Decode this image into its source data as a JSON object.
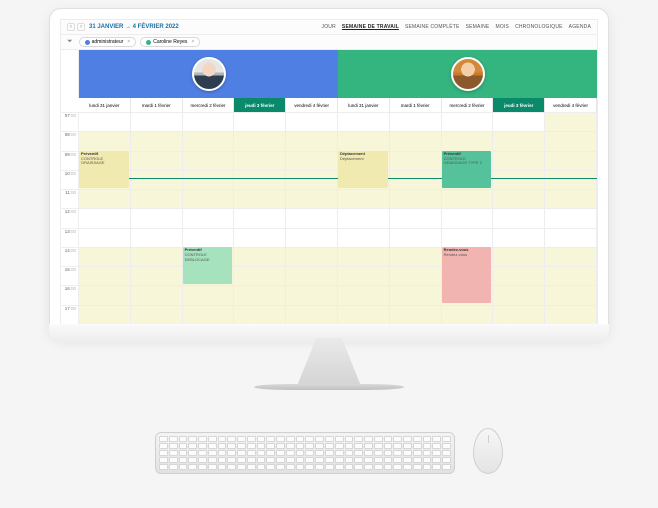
{
  "header": {
    "date_range": "31 JANVIER → 4 FÉVRIER 2022",
    "views": [
      {
        "label": "JOUR",
        "active": false
      },
      {
        "label": "SEMAINE DE TRAVAIL",
        "active": true
      },
      {
        "label": "SEMAINE COMPLÈTE",
        "active": false
      },
      {
        "label": "SEMAINE",
        "active": false
      },
      {
        "label": "MOIS",
        "active": false
      },
      {
        "label": "CHRONOLOGIQUE",
        "active": false
      },
      {
        "label": "AGENDA",
        "active": false
      }
    ]
  },
  "filters": [
    {
      "label": "administrateur",
      "color": "blue"
    },
    {
      "label": "Caroline Reyes",
      "color": "green"
    }
  ],
  "people": [
    {
      "name": "administrateur",
      "color": "blue"
    },
    {
      "name": "Caroline Reyes",
      "color": "green"
    }
  ],
  "days": [
    {
      "label": "lundi 31 janvier",
      "active": false
    },
    {
      "label": "mardi 1 février",
      "active": false
    },
    {
      "label": "mercredi 2 février",
      "active": false
    },
    {
      "label": "jeudi 3 février",
      "active": true
    },
    {
      "label": "vendredi 4 février",
      "active": false
    },
    {
      "label": "lundi 31 janvier",
      "active": false
    },
    {
      "label": "mardi 1 février",
      "active": false
    },
    {
      "label": "mercredi 2 février",
      "active": false
    },
    {
      "label": "jeudi 3 février",
      "active": true
    },
    {
      "label": "vendredi 4 février",
      "active": false
    }
  ],
  "hours": [
    "07",
    "08",
    "09",
    "10",
    "11",
    "12",
    "13",
    "14",
    "15",
    "16",
    "17"
  ],
  "events": [
    {
      "col": 0,
      "row": 2,
      "h": 2,
      "cls": "ev-yellow",
      "title": "Préventif",
      "sub": "CONTROLE GRAISSAGE"
    },
    {
      "col": 2,
      "row": 7,
      "h": 2,
      "cls": "ev-green",
      "title": "Préventif",
      "sub": "CONTROLE DEBLOCAGE"
    },
    {
      "col": 5,
      "row": 2,
      "h": 2,
      "cls": "ev-yellow",
      "title": "Déplacement",
      "sub": "Déplacement"
    },
    {
      "col": 7,
      "row": 2,
      "h": 2,
      "cls": "ev-teal",
      "title": "Préventif",
      "sub": "CONTROLE GRAISSAGE TYPE 2"
    },
    {
      "col": 7,
      "row": 7,
      "h": 3,
      "cls": "ev-pink",
      "title": "Rendez-vous",
      "sub": "Rendez-vous"
    }
  ],
  "now_hour_label": ":00"
}
